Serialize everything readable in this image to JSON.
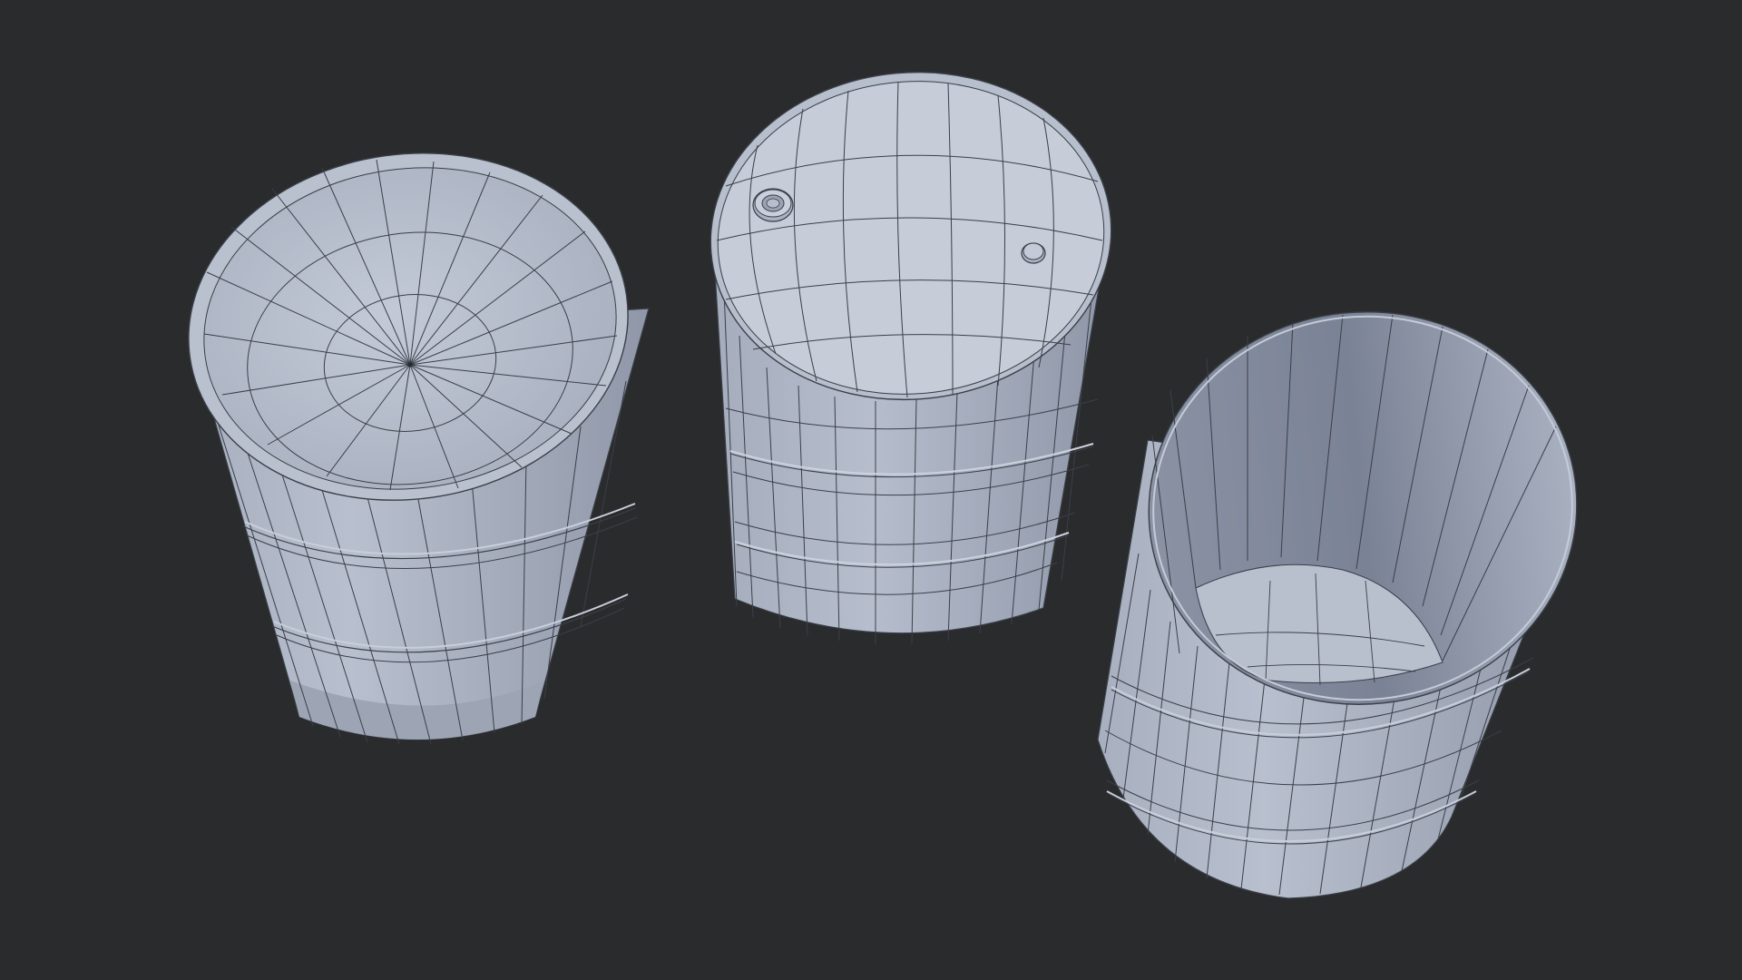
{
  "scene": {
    "background_color": "#2a2b2c",
    "mesh_color": "#b4bccc",
    "wire_color": "#3a3f48",
    "objects": [
      {
        "name": "barrel-open-dished-top",
        "description_visible": ""
      },
      {
        "name": "barrel-closed-lid-with-bungs",
        "description_visible": ""
      },
      {
        "name": "barrel-open-hollow",
        "description_visible": ""
      }
    ]
  }
}
